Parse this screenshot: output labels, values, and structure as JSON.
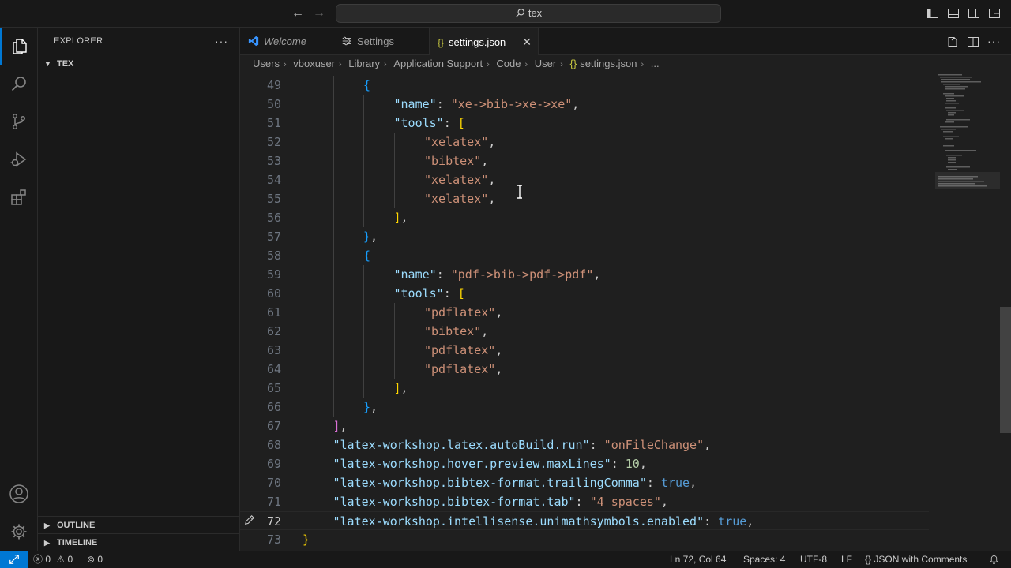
{
  "titlebar": {
    "search_text": "tex"
  },
  "sidebar": {
    "title": "EXPLORER",
    "folder_name": "TEX",
    "outline_label": "OUTLINE",
    "timeline_label": "TIMELINE"
  },
  "tabs": [
    {
      "label": "Welcome",
      "icon": "vscode-logo-icon",
      "active": false
    },
    {
      "label": "Settings",
      "icon": "settings-icon",
      "active": false
    },
    {
      "label": "settings.json",
      "icon": "braces-icon",
      "active": true
    }
  ],
  "breadcrumb": [
    "Users",
    "vboxuser",
    "Library",
    "Application Support",
    "Code",
    "User",
    "settings.json",
    "..."
  ],
  "editor": {
    "current_line": 72,
    "lines": [
      {
        "n": "49",
        "indent": 2,
        "tokens": [
          [
            "{",
            "b3"
          ]
        ]
      },
      {
        "n": "50",
        "indent": 3,
        "tokens": [
          [
            "\"name\"",
            "tk-key"
          ],
          [
            ": ",
            "tk-p"
          ],
          [
            "\"xe->bib->xe->xe\"",
            "tk-str"
          ],
          [
            ",",
            "tk-p"
          ]
        ]
      },
      {
        "n": "51",
        "indent": 3,
        "tokens": [
          [
            "\"tools\"",
            "tk-key"
          ],
          [
            ": ",
            "tk-p"
          ],
          [
            "[",
            "b1"
          ]
        ]
      },
      {
        "n": "52",
        "indent": 4,
        "tokens": [
          [
            "\"xelatex\"",
            "tk-str"
          ],
          [
            ",",
            "tk-p"
          ]
        ]
      },
      {
        "n": "53",
        "indent": 4,
        "tokens": [
          [
            "\"bibtex\"",
            "tk-str"
          ],
          [
            ",",
            "tk-p"
          ]
        ]
      },
      {
        "n": "54",
        "indent": 4,
        "tokens": [
          [
            "\"xelatex\"",
            "tk-str"
          ],
          [
            ",",
            "tk-p"
          ]
        ]
      },
      {
        "n": "55",
        "indent": 4,
        "tokens": [
          [
            "\"xelatex\"",
            "tk-str"
          ],
          [
            ",",
            "tk-p"
          ]
        ]
      },
      {
        "n": "56",
        "indent": 3,
        "tokens": [
          [
            "]",
            "b1"
          ],
          [
            ",",
            "tk-p"
          ]
        ]
      },
      {
        "n": "57",
        "indent": 2,
        "tokens": [
          [
            "}",
            "b3"
          ],
          [
            ",",
            "tk-p"
          ]
        ]
      },
      {
        "n": "58",
        "indent": 2,
        "tokens": [
          [
            "{",
            "b3"
          ]
        ]
      },
      {
        "n": "59",
        "indent": 3,
        "tokens": [
          [
            "\"name\"",
            "tk-key"
          ],
          [
            ": ",
            "tk-p"
          ],
          [
            "\"pdf->bib->pdf->pdf\"",
            "tk-str"
          ],
          [
            ",",
            "tk-p"
          ]
        ]
      },
      {
        "n": "60",
        "indent": 3,
        "tokens": [
          [
            "\"tools\"",
            "tk-key"
          ],
          [
            ": ",
            "tk-p"
          ],
          [
            "[",
            "b1"
          ]
        ]
      },
      {
        "n": "61",
        "indent": 4,
        "tokens": [
          [
            "\"pdflatex\"",
            "tk-str"
          ],
          [
            ",",
            "tk-p"
          ]
        ]
      },
      {
        "n": "62",
        "indent": 4,
        "tokens": [
          [
            "\"bibtex\"",
            "tk-str"
          ],
          [
            ",",
            "tk-p"
          ]
        ]
      },
      {
        "n": "63",
        "indent": 4,
        "tokens": [
          [
            "\"pdflatex\"",
            "tk-str"
          ],
          [
            ",",
            "tk-p"
          ]
        ]
      },
      {
        "n": "64",
        "indent": 4,
        "tokens": [
          [
            "\"pdflatex\"",
            "tk-str"
          ],
          [
            ",",
            "tk-p"
          ]
        ]
      },
      {
        "n": "65",
        "indent": 3,
        "tokens": [
          [
            "]",
            "b1"
          ],
          [
            ",",
            "tk-p"
          ]
        ]
      },
      {
        "n": "66",
        "indent": 2,
        "tokens": [
          [
            "}",
            "b3"
          ],
          [
            ",",
            "tk-p"
          ]
        ]
      },
      {
        "n": "67",
        "indent": 1,
        "tokens": [
          [
            "]",
            "b2"
          ],
          [
            ",",
            "tk-p"
          ]
        ]
      },
      {
        "n": "68",
        "indent": 1,
        "tokens": [
          [
            "\"latex-workshop.latex.autoBuild.run\"",
            "tk-key"
          ],
          [
            ": ",
            "tk-p"
          ],
          [
            "\"onFileChange\"",
            "tk-str"
          ],
          [
            ",",
            "tk-p"
          ]
        ]
      },
      {
        "n": "69",
        "indent": 1,
        "tokens": [
          [
            "\"latex-workshop.hover.preview.maxLines\"",
            "tk-key"
          ],
          [
            ": ",
            "tk-p"
          ],
          [
            "10",
            "tk-num"
          ],
          [
            ",",
            "tk-p"
          ]
        ]
      },
      {
        "n": "70",
        "indent": 1,
        "tokens": [
          [
            "\"latex-workshop.bibtex-format.trailingComma\"",
            "tk-key"
          ],
          [
            ": ",
            "tk-p"
          ],
          [
            "true",
            "tk-bool"
          ],
          [
            ",",
            "tk-p"
          ]
        ]
      },
      {
        "n": "71",
        "indent": 1,
        "tokens": [
          [
            "\"latex-workshop.bibtex-format.tab\"",
            "tk-key"
          ],
          [
            ": ",
            "tk-p"
          ],
          [
            "\"4 spaces\"",
            "tk-str"
          ],
          [
            ",",
            "tk-p"
          ]
        ]
      },
      {
        "n": "72",
        "indent": 1,
        "tokens": [
          [
            "\"latex-workshop.intellisense.unimathsymbols.enabled\"",
            "tk-key"
          ],
          [
            ": ",
            "tk-p"
          ],
          [
            "true",
            "tk-bool"
          ],
          [
            ",",
            "tk-p"
          ]
        ]
      },
      {
        "n": "73",
        "indent": 0,
        "tokens": [
          [
            "}",
            "b1"
          ]
        ]
      }
    ]
  },
  "statusbar": {
    "errors": "0",
    "warnings": "0",
    "ports": "0",
    "position": "Ln 72, Col 64",
    "spaces": "Spaces: 4",
    "encoding": "UTF-8",
    "eol": "LF",
    "language": "JSON with Comments"
  },
  "colors": {
    "accent": "#0078d4",
    "key": "#9cdcfe",
    "string": "#ce9178",
    "number": "#b5cea8",
    "boolean": "#569cd6"
  }
}
